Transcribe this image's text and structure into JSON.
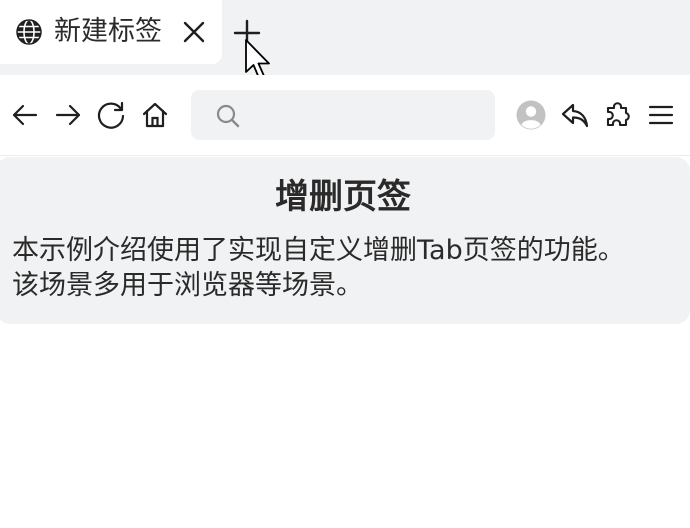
{
  "tab": {
    "title": "新建标签",
    "globe_icon": "globe-icon",
    "close_icon": "close-icon"
  },
  "new_tab": {
    "icon": "plus-icon"
  },
  "toolbar": {
    "icons": [
      "back-arrow-icon",
      "forward-arrow-icon",
      "refresh-icon",
      "home-icon",
      "avatar-icon",
      "reply-icon",
      "extension-icon",
      "menu-icon"
    ],
    "search": {
      "value": "",
      "placeholder": ""
    }
  },
  "card": {
    "title": "增删页签",
    "description_lines": [
      "本示例介绍使用了实现自定义增删Tab页签的功能。",
      "该场景多用于浏览器等场景。"
    ]
  },
  "colors": {
    "tabbar_bg": "#f1f2f3",
    "card_bg": "#f1f2f3",
    "text": "#2a2a2a",
    "icon": "#1f1f1f"
  }
}
